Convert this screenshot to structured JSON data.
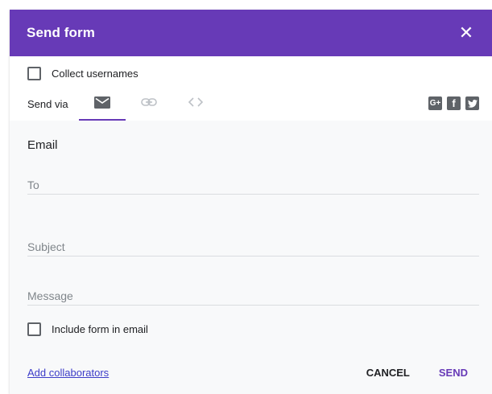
{
  "dialog": {
    "title": "Send form",
    "close_glyph": "✕"
  },
  "options": {
    "collect_usernames_label": "Collect usernames",
    "collect_usernames_checked": false
  },
  "send_via": {
    "label": "Send via",
    "tabs": [
      {
        "name": "email",
        "icon": "envelope-icon",
        "active": true
      },
      {
        "name": "link",
        "icon": "link-icon",
        "active": false
      },
      {
        "name": "embed",
        "icon": "code-icon",
        "active": false
      }
    ],
    "social": [
      {
        "name": "google-plus",
        "icon": "google-plus-icon",
        "glyph": "G+"
      },
      {
        "name": "facebook",
        "icon": "facebook-icon",
        "glyph": "f"
      },
      {
        "name": "twitter",
        "icon": "twitter-icon",
        "glyph": ""
      }
    ]
  },
  "email": {
    "section_title": "Email",
    "to": {
      "placeholder": "To",
      "value": ""
    },
    "subject": {
      "placeholder": "Subject",
      "value": ""
    },
    "message": {
      "placeholder": "Message",
      "value": ""
    },
    "include_form_label": "Include form in email",
    "include_form_checked": false
  },
  "footer": {
    "add_collaborators": "Add collaborators",
    "cancel": "CANCEL",
    "send": "SEND"
  },
  "colors": {
    "accent": "#673ab7",
    "link": "#3c3cc8",
    "icon_gray": "#5f6368"
  }
}
